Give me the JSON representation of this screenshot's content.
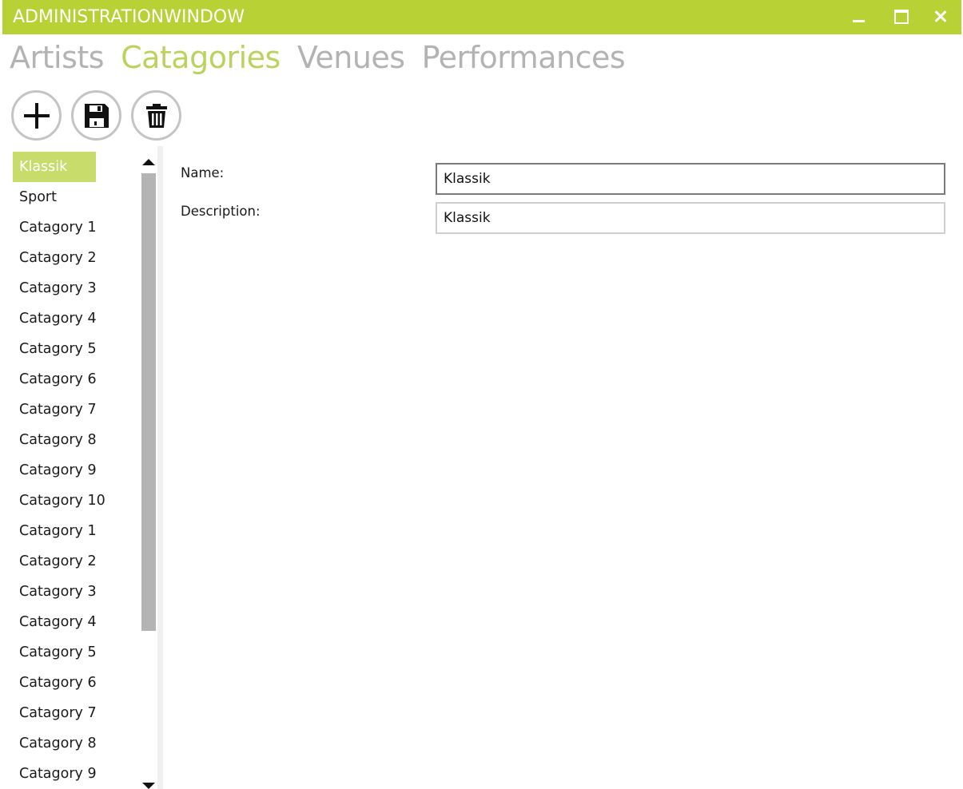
{
  "window": {
    "title": "ADMINISTRATIONWINDOW"
  },
  "nav": {
    "tabs": [
      {
        "label": "Artists"
      },
      {
        "label": "Catagories"
      },
      {
        "label": "Venues"
      },
      {
        "label": "Performances"
      }
    ],
    "active": "Catagories"
  },
  "toolbar": {
    "buttons": [
      "add-icon",
      "save-icon",
      "delete-icon"
    ]
  },
  "list": {
    "selected": "Klassik",
    "items": [
      "Klassik",
      "Sport",
      "Catagory 1",
      "Catagory 2",
      "Catagory 3",
      "Catagory 4",
      "Catagory 5",
      "Catagory 6",
      "Catagory 7",
      "Catagory 8",
      "Catagory 9",
      "Catagory 10",
      "Catagory 1",
      "Catagory 2",
      "Catagory 3",
      "Catagory 4",
      "Catagory 5",
      "Catagory 6",
      "Catagory 7",
      "Catagory 8",
      "Catagory 9"
    ]
  },
  "form": {
    "name_label": "Name:",
    "name_value": "Klassik",
    "description_label": "Description:",
    "description_value": "Klassik"
  },
  "colors": {
    "accent": "#b8d135",
    "tab_active": "#bcd25f",
    "tab_inactive": "#b3b3b3",
    "selection": "#c7dc6a"
  }
}
